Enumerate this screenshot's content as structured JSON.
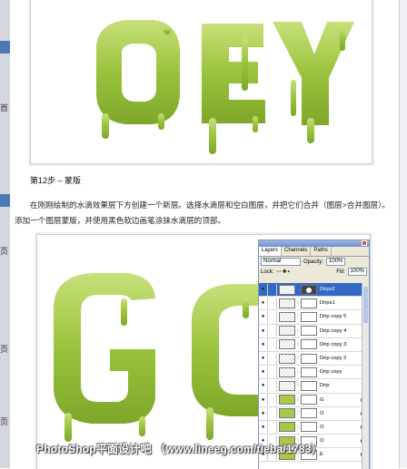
{
  "article": {
    "step_title": "第12步 – 蒙版",
    "paragraph": "在刚刚绘制的水滴效果层下方创建一个新层。选择水滴层和空白图层，并把它们合并（图层>合并图层）。添加一个图层蒙版，并使用黑色软边画笔涂抹水滴层的顶部。",
    "watermark": "PhotoShop平面设计吧 （www.lineeg.com/tieba/1783）"
  },
  "left_strip": {
    "glyphs": [
      "?",
      "首",
      "页",
      "?",
      "页",
      "页"
    ]
  },
  "images": {
    "top_text": "OEY",
    "bottom_text": "GC",
    "slime_color": "#98c23a"
  },
  "layers_panel": {
    "tabs": [
      "Layers",
      "Channels",
      "Paths"
    ],
    "active_tab": "Layers",
    "blend_mode": "Normal",
    "opacity_label": "Opacity:",
    "opacity_value": "100%",
    "lock_label": "Lock:",
    "fill_label": "Fill:",
    "fill_value": "100%",
    "layers": [
      {
        "name": "Drips2",
        "selected": true,
        "thumb": "checker",
        "mask": "dark"
      },
      {
        "name": "Drips1",
        "selected": false,
        "thumb": "checker",
        "mask": "light"
      },
      {
        "name": "Drip copy 5",
        "selected": false,
        "thumb": "checker",
        "mask": "light"
      },
      {
        "name": "Drip copy 4",
        "selected": false,
        "thumb": "checker",
        "mask": "light"
      },
      {
        "name": "Drip copy 3",
        "selected": false,
        "thumb": "checker",
        "mask": "light"
      },
      {
        "name": "Drip copy 2",
        "selected": false,
        "thumb": "checker",
        "mask": "light"
      },
      {
        "name": "Drip copy",
        "selected": false,
        "thumb": "checker",
        "mask": "light"
      },
      {
        "name": "Drip",
        "selected": false,
        "thumb": "checker",
        "mask": "light"
      },
      {
        "name": "G",
        "selected": false,
        "thumb": "green",
        "mask": "light",
        "fx": true
      },
      {
        "name": "O",
        "selected": false,
        "thumb": "green",
        "mask": "light",
        "fx": true
      },
      {
        "name": "O",
        "selected": false,
        "thumb": "green",
        "mask": "light",
        "fx": true
      },
      {
        "name": "O",
        "selected": false,
        "thumb": "green",
        "mask": "light",
        "fx": true
      },
      {
        "name": "E",
        "selected": false,
        "thumb": "green",
        "mask": "light",
        "fx": true
      }
    ]
  }
}
